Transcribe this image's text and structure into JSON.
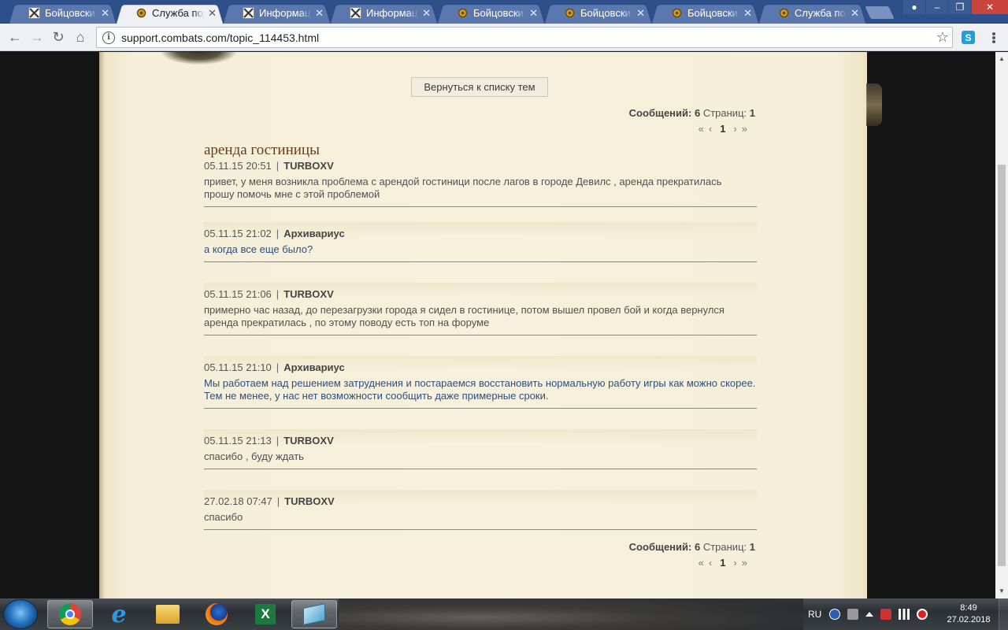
{
  "browser": {
    "tabs": [
      {
        "title": "Бойцовский клуб",
        "icon": "combats-x-icon",
        "active": false
      },
      {
        "title": "Служба поддержки",
        "icon": "support-sun-icon",
        "active": true
      },
      {
        "title": "Информация о персонаже",
        "icon": "combats-x-icon",
        "active": false
      },
      {
        "title": "Информация о персонаже",
        "icon": "combats-x-icon",
        "active": false
      },
      {
        "title": "Бойцовский клуб",
        "icon": "support-sun-icon",
        "active": false
      },
      {
        "title": "Бойцовский клуб",
        "icon": "support-sun-icon",
        "active": false
      },
      {
        "title": "Бойцовский клуб",
        "icon": "support-sun-icon",
        "active": false
      },
      {
        "title": "Служба поддержки",
        "icon": "support-sun-icon",
        "active": false
      }
    ],
    "tab_close_glyph": "✕",
    "url": "support.combats.com/topic_114453.html",
    "ext_skype_label": "S"
  },
  "page": {
    "back_button": "Вернуться к списку тем",
    "stats": {
      "messages_label": "Сообщений:",
      "messages_count": "6",
      "pages_label": "Страниц:",
      "pages_count": "1"
    },
    "pager": {
      "first": "«",
      "prev": "‹",
      "current": "1",
      "next": "›",
      "last": "»"
    },
    "topic_title": "аренда гостиницы",
    "separator": "|",
    "posts": [
      {
        "date": "05.11.15 20:51",
        "author": "TURBOXV",
        "lines": [
          "привет, у меня возникла проблема с арендой гостиници после лагов в городе Девилс , аренда прекратилась",
          "прошу помочь мне с этой проблемой"
        ],
        "staff": false
      },
      {
        "date": "05.11.15 21:02",
        "author": "Архивариус",
        "lines": [
          "а когда все еще было?"
        ],
        "staff": true
      },
      {
        "date": "05.11.15 21:06",
        "author": "TURBOXV",
        "lines": [
          "примерно час назад, до перезагрузки города я сидел в гостинице, потом вышел провел бой и когда вернулся",
          "аренда прекратилась , по этому поводу есть топ на форуме"
        ],
        "staff": false
      },
      {
        "date": "05.11.15 21:10",
        "author": "Архивариус",
        "lines": [
          "Мы работаем над решением затруднения и постараемся восстановить нормальную работу игры как можно скорее.",
          "Тем не менее, у нас нет возможности сообщить даже примерные сроки."
        ],
        "staff": true
      },
      {
        "date": "05.11.15 21:13",
        "author": "TURBOXV",
        "lines": [
          "спасибо , буду ждать"
        ],
        "staff": false
      },
      {
        "date": "27.02.18 07:47",
        "author": "TURBOXV",
        "lines": [
          "спасибо"
        ],
        "staff": false
      }
    ]
  },
  "taskbar": {
    "apps": [
      "chrome-icon",
      "ie-icon",
      "explorer-folder-icon",
      "firefox-icon",
      "excel-icon",
      "app-window-icon"
    ],
    "excel_label": "X",
    "ie_label": "e",
    "lang": "RU",
    "time": "8:49",
    "date": "27.02.2018"
  },
  "colors": {
    "accent_tab": "#2d4f8a",
    "paper": "#f6f0dc",
    "title": "#6e3a12",
    "staff_text": "#2e4f7a"
  }
}
